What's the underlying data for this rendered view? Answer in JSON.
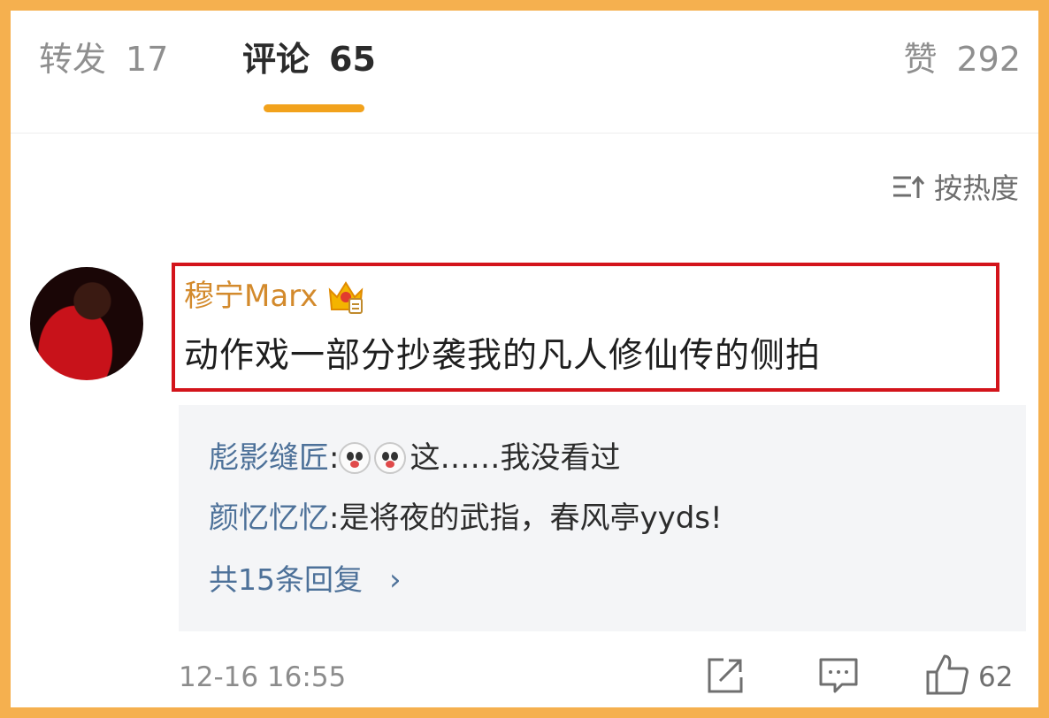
{
  "tabs": {
    "reposts": {
      "label": "转发",
      "count": "17"
    },
    "comments": {
      "label": "评论",
      "count": "65"
    },
    "likes": {
      "label": "赞",
      "count": "292"
    }
  },
  "sort": {
    "label": "按热度",
    "icon": "sort-icon"
  },
  "comment": {
    "username": "穆宁Marx",
    "text": "动作戏一部分抄袭我的凡人修仙传的侧拍",
    "time": "12-16  16:55",
    "like_count": "62",
    "highlight_color": "#d3141b"
  },
  "replies": [
    {
      "name": "彪影缝匠",
      "text": "这……我没看过"
    },
    {
      "name": "颜忆忆忆",
      "text": "是将夜的武指，春风亭yyds!"
    }
  ],
  "more_replies": "共15条回复",
  "colors": {
    "accent": "#f2a21c",
    "frame": "#f5b04f",
    "link": "#4d7199"
  }
}
